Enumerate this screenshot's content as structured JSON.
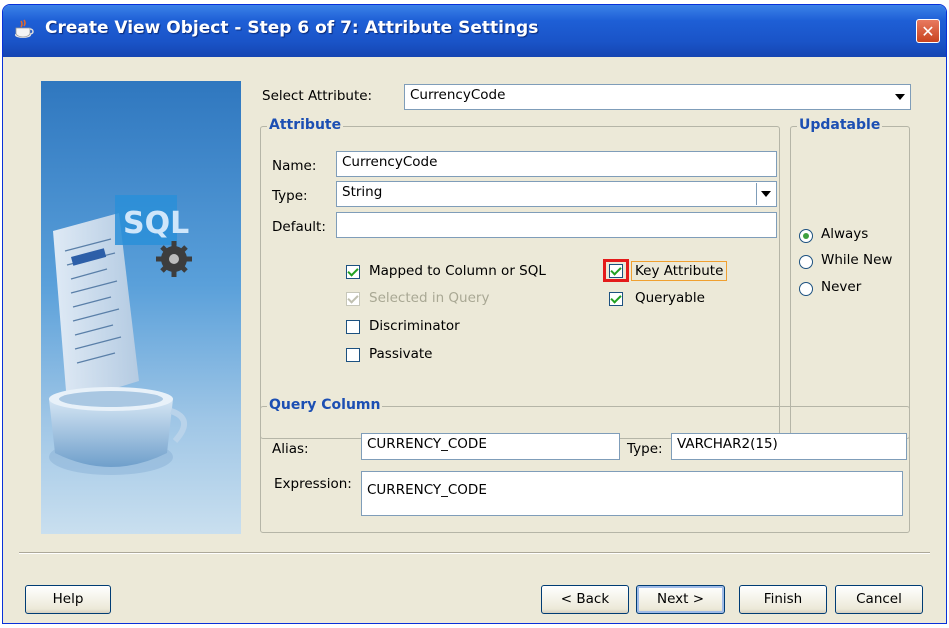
{
  "window": {
    "title": "Create View Object - Step 6 of 7: Attribute Settings",
    "close_glyph": "✕"
  },
  "select_attribute": {
    "label": "Select Attribute:",
    "value": "CurrencyCode"
  },
  "attribute_group": {
    "title": "Attribute",
    "name_label": "Name:",
    "name_value": "CurrencyCode",
    "type_label": "Type:",
    "type_value": "String",
    "default_label": "Default:",
    "default_value": "",
    "checkboxes": {
      "mapped": {
        "label": "Mapped to Column or SQL",
        "checked": true,
        "enabled": true
      },
      "selected_in_query": {
        "label": "Selected in Query",
        "checked": true,
        "enabled": false
      },
      "discriminator": {
        "label": "Discriminator",
        "checked": false,
        "enabled": true
      },
      "passivate": {
        "label": "Passivate",
        "checked": false,
        "enabled": true
      },
      "key_attribute": {
        "label": "Key Attribute",
        "checked": true,
        "enabled": true
      },
      "queryable": {
        "label": "Queryable",
        "checked": true,
        "enabled": true
      }
    }
  },
  "updatable_group": {
    "title": "Updatable",
    "options": [
      "Always",
      "While New",
      "Never"
    ],
    "selected": "Always"
  },
  "query_column_group": {
    "title": "Query Column",
    "alias_label": "Alias:",
    "alias_value": "CURRENCY_CODE",
    "type_label": "Type:",
    "type_value": "VARCHAR2(15)",
    "expression_label": "Expression:",
    "expression_value": "CURRENCY_CODE"
  },
  "buttons": {
    "help": "Help",
    "back": "< Back",
    "next": "Next >",
    "finish": "Finish",
    "cancel": "Cancel"
  },
  "wizard_image_text": "SQL",
  "colors": {
    "title_bar": "#1e5fd6",
    "group_title": "#1c4fb3",
    "highlight_box": "#e41b1b",
    "focus_outline": "#f0a030",
    "dialog_bg": "#ece9d8"
  }
}
